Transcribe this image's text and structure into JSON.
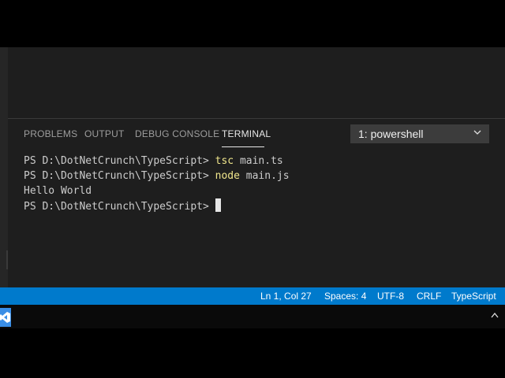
{
  "panel": {
    "tabs": [
      "PROBLEMS",
      "OUTPUT",
      "DEBUG CONSOLE",
      "TERMINAL"
    ],
    "active_tab": "TERMINAL",
    "terminal_select": "1: powershell"
  },
  "terminal": {
    "lines": [
      {
        "prompt": "PS D:\\DotNetCrunch\\TypeScript> ",
        "cmd": "tsc",
        "args": " main.ts"
      },
      {
        "prompt": "PS D:\\DotNetCrunch\\TypeScript> ",
        "cmd": "node",
        "args": " main.js"
      },
      {
        "output": "Hello World"
      },
      {
        "prompt": "PS D:\\DotNetCrunch\\TypeScript>"
      }
    ]
  },
  "status_bar": {
    "position": "Ln 1, Col 27",
    "spaces": "Spaces: 4",
    "encoding": "UTF-8",
    "eol": "CRLF",
    "language": "TypeScript"
  },
  "colors": {
    "status_bar": "#007acc",
    "panel_bg": "#1e1e1e",
    "command_highlight": "#f0e68c"
  },
  "icons": [
    "chevron-down-icon",
    "vscode-icon",
    "tray-caret-icon"
  ]
}
